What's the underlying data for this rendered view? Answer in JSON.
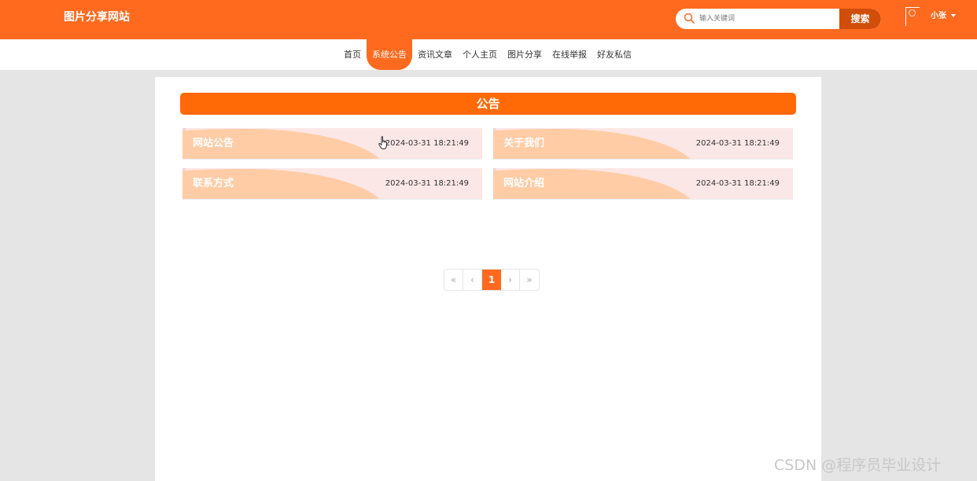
{
  "header": {
    "site_title": "图片分享网站",
    "search": {
      "placeholder": "输入关键词",
      "button_label": "搜索"
    },
    "user": {
      "name": "小张"
    }
  },
  "nav": {
    "items": [
      {
        "label": "首页",
        "active": false
      },
      {
        "label": "系统公告",
        "active": true
      },
      {
        "label": "资讯文章",
        "active": false
      },
      {
        "label": "个人主页",
        "active": false
      },
      {
        "label": "图片分享",
        "active": false
      },
      {
        "label": "在线举报",
        "active": false
      },
      {
        "label": "好友私信",
        "active": false
      }
    ]
  },
  "notices": {
    "title": "公告",
    "items": [
      {
        "title": "网站公告",
        "date": "2024-03-31 18:21:49"
      },
      {
        "title": "关于我们",
        "date": "2024-03-31 18:21:49"
      },
      {
        "title": "联系方式",
        "date": "2024-03-31 18:21:49"
      },
      {
        "title": "网站介绍",
        "date": "2024-03-31 18:21:49"
      }
    ]
  },
  "pagination": {
    "first": "«",
    "prev": "‹",
    "current": "1",
    "next": "›",
    "last": "»"
  },
  "watermark": "CSDN @程序员毕业设计",
  "colors": {
    "brand": "#ff6a1f",
    "title_bar": "#ff6a06",
    "search_button": "#d04e0a",
    "card_bg": "#fbe7e5",
    "card_wave": "#ffcca6"
  }
}
